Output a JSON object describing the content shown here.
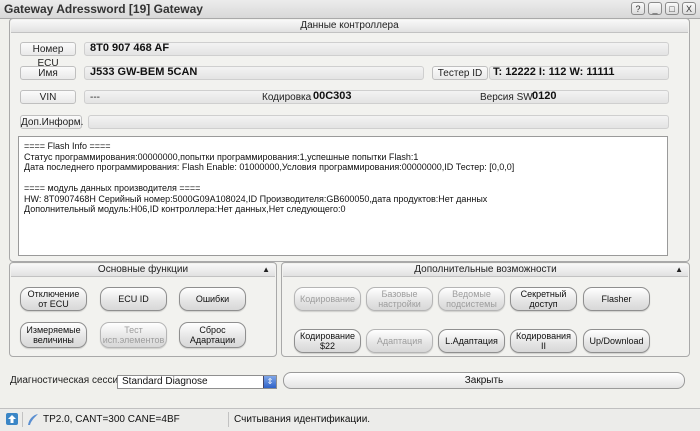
{
  "window": {
    "title": "Gateway Adressword [19] Gateway",
    "buttons": [
      "?",
      "_",
      "□",
      "X"
    ]
  },
  "controller": {
    "header": "Данные контроллера",
    "ecu_number_label": "Номер ECU",
    "ecu_number_value": "8T0 907 468 AF",
    "name_label": "Имя",
    "name_value": "J533 GW-BEM 5CAN",
    "tester_id_label": "Тестер ID",
    "tester_id_value": "T: 12222 I: 112 W: 11111",
    "vin_label": "VIN",
    "vin_value": "---",
    "coding_label": "Кодировка",
    "coding_value": "00C303",
    "sw_version_label": "Версия SW",
    "sw_version_value": "0120",
    "extra_info_label": "Доп.Информ.",
    "info_lines": [
      "==== Flash Info ====",
      "Статус программирования:00000000,попытки программирования:1,успешные попытки Flash:1",
      "Дата последнего программирования: Flash Enable: 01000000,Условия программирования:00000000,ID Тестер: [0,0,0]",
      "",
      "==== модуль данных производителя ====",
      "HW: 8T0907468H  Серийный номер:5000G09A108024,ID Производителя:GB600050,дата продуктов:Нет данных",
      "Дополнительный модуль:H06,ID контроллера:Нет данных,Нет следующего:0"
    ]
  },
  "basic": {
    "header": "Основные функции",
    "buttons": {
      "disconnect": "Отключение от ECU",
      "ecu_id": "ECU ID",
      "errors": "Ошибки",
      "measured": "Измеряемые величины",
      "test": "Тест исп.элементов",
      "reset": "Сброс Адартации"
    }
  },
  "extra": {
    "header": "Дополнительные возможности",
    "buttons": {
      "coding": "Кодирование",
      "basic_settings": "Базовые настройки",
      "slave": "Ведомые подсистемы",
      "secret": "Секретный доступ",
      "flasher": "Flasher",
      "coding22": "Кодирование $22",
      "adaptation": "Адаптация",
      "l_adaptation": "L.Адаптация",
      "coding2": "Кодирования II",
      "updownload": "Up/Download"
    }
  },
  "session": {
    "label": "Диагностическая сессия",
    "value": "Standard Diagnose",
    "close": "Закрыть"
  },
  "status": {
    "protocol": "TP2.0, CANT=300 CANE=4BF",
    "message": "Считывания идентификации."
  }
}
